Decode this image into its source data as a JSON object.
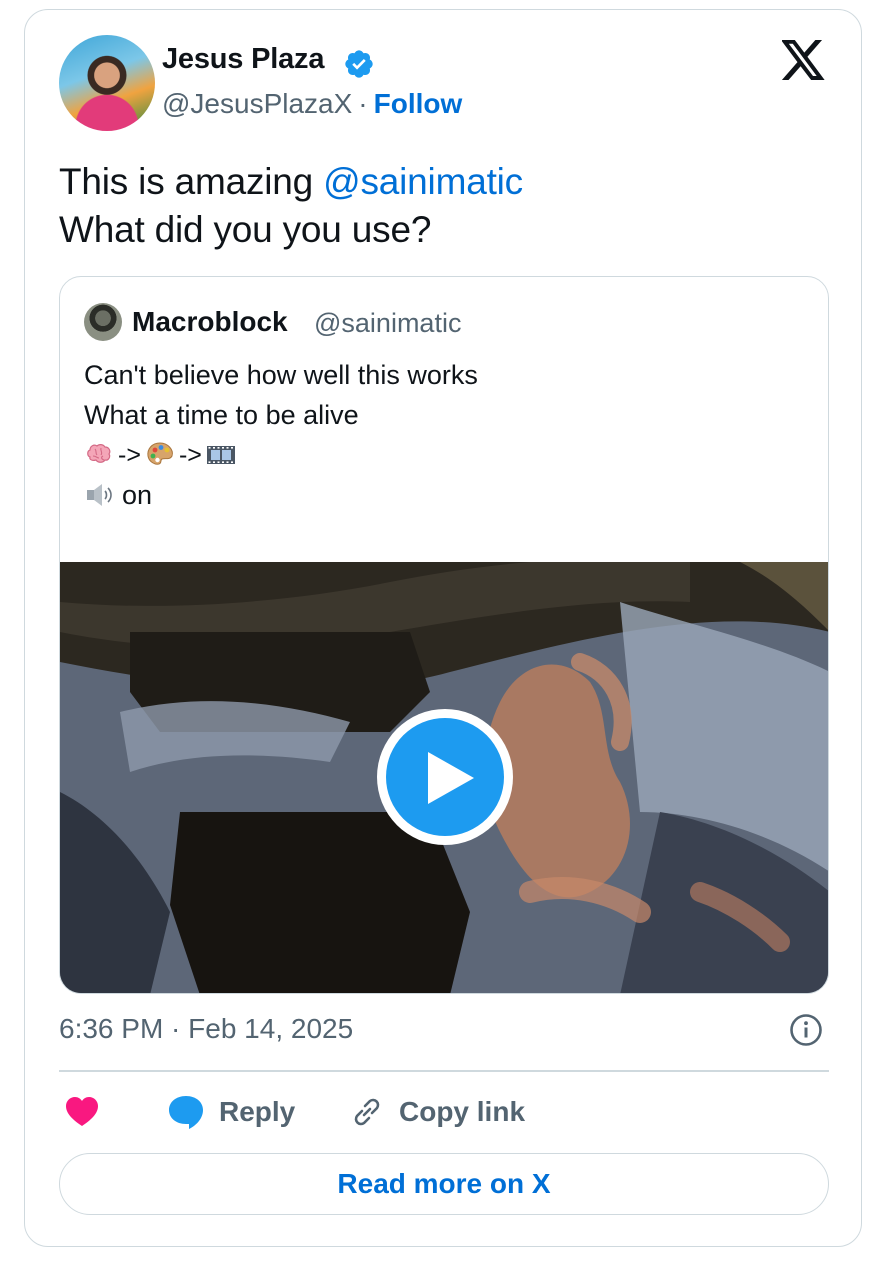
{
  "author": {
    "name": "Jesus Plaza",
    "handle": "@JesusPlazaX",
    "separator": "·",
    "follow_label": "Follow"
  },
  "tweet": {
    "line1_prefix": "This is amazing ",
    "mention": "@sainimatic",
    "line2": "What did you you use?"
  },
  "quoted_tweet": {
    "name": "Macroblock",
    "handle": "@sainimatic",
    "line1": "Can't believe how well this works",
    "line2": "What a time to be alive",
    "emoji_sequence": {
      "items": [
        "brain-emoji",
        "artist-palette-emoji",
        "film-frames-emoji"
      ],
      "arrow": "->"
    },
    "speaker_icon": "speaker-high-volume-emoji",
    "speaker_text": "on"
  },
  "video": {
    "play_icon": "play-icon",
    "accent_color": "#1d9bf0"
  },
  "meta": {
    "timestamp": "6:36 PM · Feb 14, 2025"
  },
  "actions": {
    "like_icon": "heart-icon",
    "reply_label": "Reply",
    "copy_label": "Copy link",
    "read_more_label": "Read more on X"
  },
  "colors": {
    "link": "#006fd6",
    "heart": "#f91880",
    "verified": "#1d9bf0",
    "muted_text": "#536471",
    "border": "#cfd9de"
  }
}
